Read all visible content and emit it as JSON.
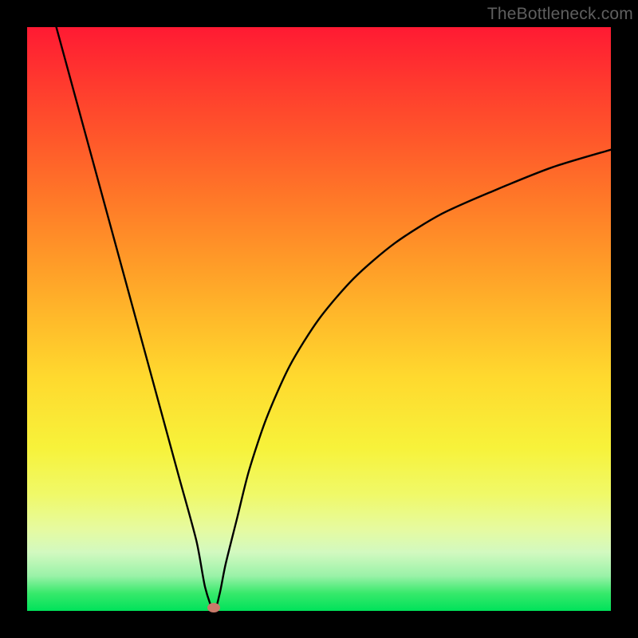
{
  "watermark": "TheBottleneck.com",
  "colors": {
    "gradient_top": "#ff1a33",
    "gradient_bottom": "#00e25a",
    "curve": "#000000",
    "marker": "#c97a6a",
    "background": "#000000"
  },
  "chart_data": {
    "type": "line",
    "title": "",
    "xlabel": "",
    "ylabel": "",
    "xlim": [
      0,
      100
    ],
    "ylim": [
      0,
      100
    ],
    "x": [
      5,
      8,
      11,
      14,
      17,
      20,
      23,
      26,
      29,
      30.5,
      32,
      33,
      34,
      36,
      38,
      41,
      45,
      50,
      56,
      63,
      71,
      80,
      90,
      100
    ],
    "values": [
      100,
      89,
      78,
      67,
      56,
      45,
      34,
      23,
      12,
      4,
      0,
      3,
      8,
      16,
      24,
      33,
      42,
      50,
      57,
      63,
      68,
      72,
      76,
      79
    ],
    "series": [
      {
        "name": "bottleneck-curve",
        "x": [
          5,
          8,
          11,
          14,
          17,
          20,
          23,
          26,
          29,
          30.5,
          32,
          33,
          34,
          36,
          38,
          41,
          45,
          50,
          56,
          63,
          71,
          80,
          90,
          100
        ],
        "values": [
          100,
          89,
          78,
          67,
          56,
          45,
          34,
          23,
          12,
          4,
          0,
          3,
          8,
          16,
          24,
          33,
          42,
          50,
          57,
          63,
          68,
          72,
          76,
          79
        ]
      }
    ],
    "marker": {
      "x": 32,
      "y": 0
    },
    "grid": false,
    "legend": false
  }
}
